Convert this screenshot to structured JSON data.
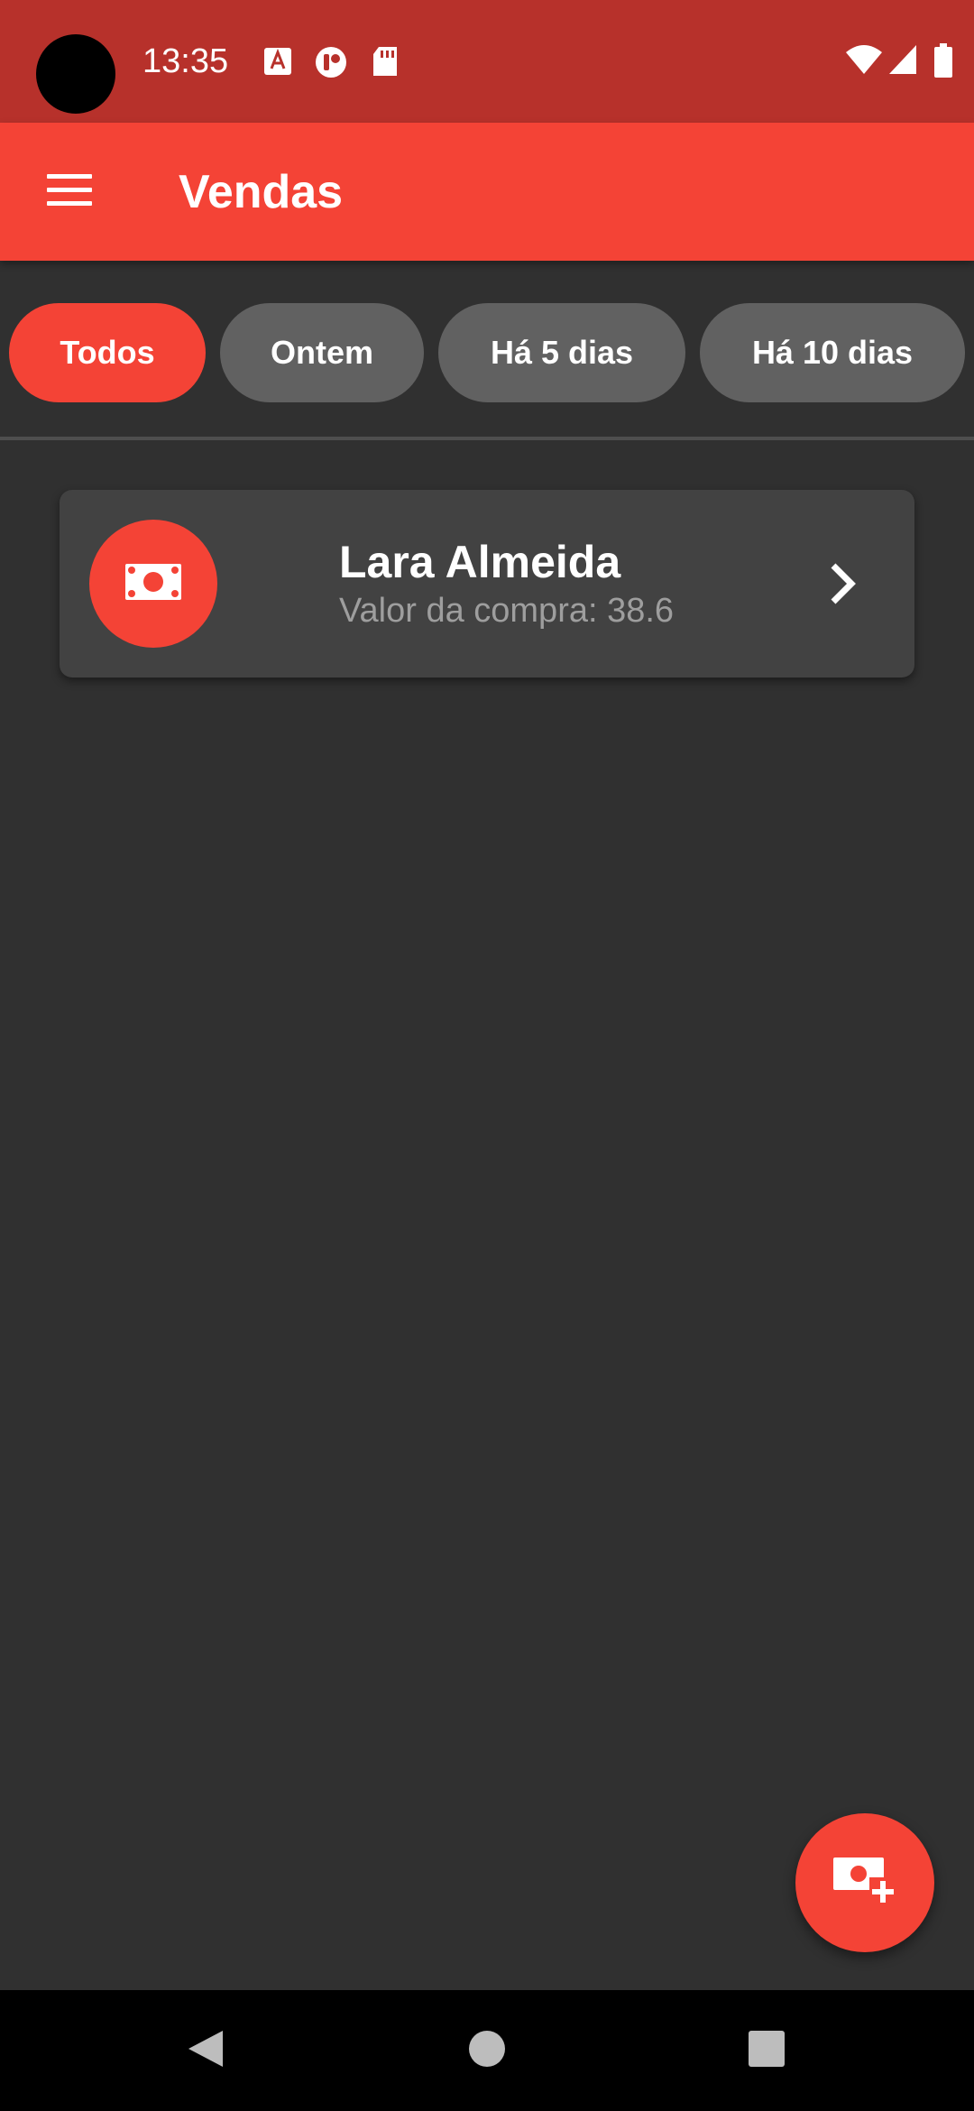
{
  "status_bar": {
    "time": "13:35",
    "left_icons": [
      "pdf-icon",
      "app-notification-icon",
      "sd-card-icon"
    ],
    "right_icons": [
      "wifi-icon",
      "cellular-signal-icon",
      "battery-icon"
    ]
  },
  "app_bar": {
    "title": "Vendas",
    "menu_icon": "menu-icon"
  },
  "filters": {
    "selected": "Todos",
    "chips": [
      {
        "label": "Todos"
      },
      {
        "label": "Ontem"
      },
      {
        "label": "Há 5 dias"
      },
      {
        "label": "Há 10 dias"
      }
    ]
  },
  "sales": [
    {
      "icon": "money-icon",
      "name": "Lara Almeida",
      "value_text": "Valor da compra: 38.6"
    }
  ],
  "fab": {
    "icon": "add-money-icon"
  },
  "nav_bar": {
    "icons": [
      "back-icon",
      "home-icon",
      "recents-icon"
    ]
  },
  "colors": {
    "primary": "#f44336",
    "status_bar": "#b7312b",
    "background": "#303030",
    "card": "#424242",
    "chip": "#616161",
    "secondary_text": "#9e9e9e"
  }
}
